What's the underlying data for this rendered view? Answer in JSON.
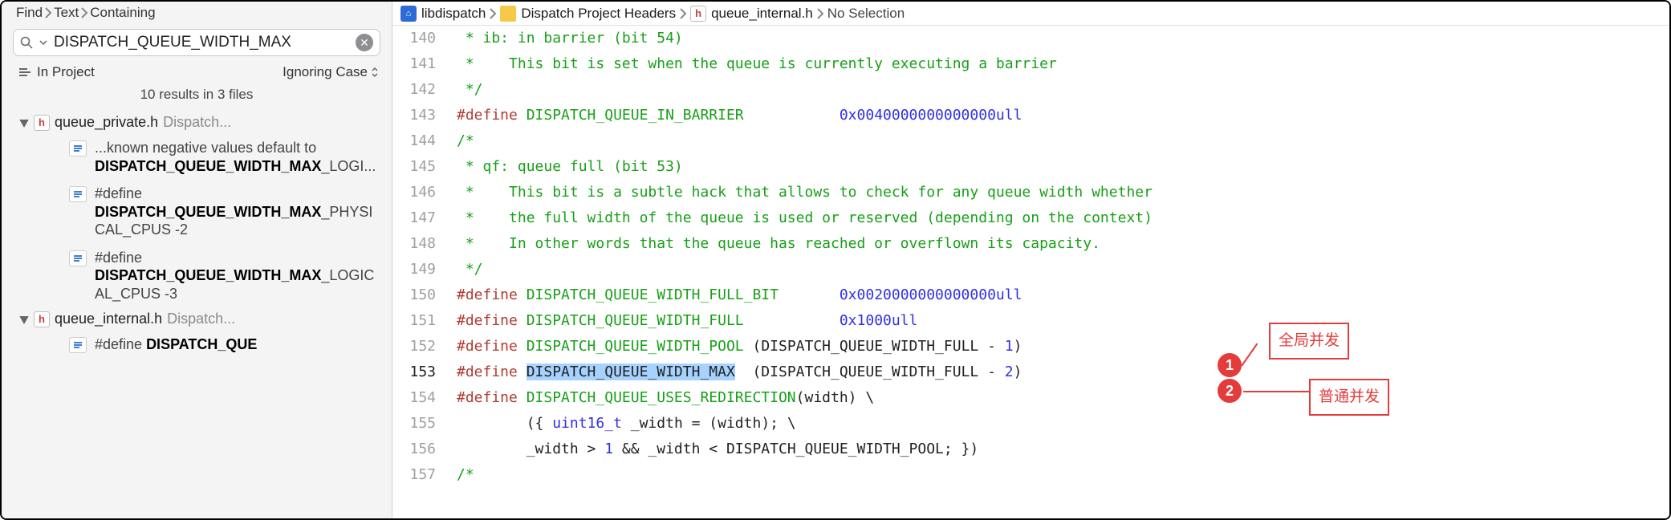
{
  "sidebar": {
    "breadcrumbs": [
      "Find",
      "Text",
      "Containing"
    ],
    "search_value": "DISPATCH_QUEUE_WIDTH_MAX",
    "scope_label": "In Project",
    "case_label": "Ignoring Case",
    "summary": "10 results in 3 files",
    "files": [
      {
        "name": "queue_private.h",
        "trail": "Dispatch...",
        "matches": [
          {
            "pre": "...known negative values default to ",
            "hit": "DISPATCH_QUEUE_WIDTH_MAX",
            "post": "_LOGI..."
          },
          {
            "pre": "#define ",
            "hit": "DISPATCH_QUEUE_WIDTH_MAX",
            "post": "_PHYSICAL_CPUS    -2"
          },
          {
            "pre": "#define ",
            "hit": "DISPATCH_QUEUE_WIDTH_MAX",
            "post": "_LOGICAL_CPUS    -3"
          }
        ]
      },
      {
        "name": "queue_internal.h",
        "trail": "Dispatch...",
        "matches": [
          {
            "pre": "#define ",
            "hit": "DISPATCH_QUE",
            "post": ""
          }
        ]
      }
    ]
  },
  "pathbar": {
    "project": "libdispatch",
    "folder": "Dispatch Project Headers",
    "file": "queue_internal.h",
    "selection": "No Selection"
  },
  "code": {
    "first_line": 140,
    "current_line": 153,
    "lines": [
      {
        "n": 140,
        "segs": [
          [
            "c-comment",
            " * ib: in barrier (bit 54)"
          ]
        ]
      },
      {
        "n": 141,
        "segs": [
          [
            "c-comment",
            " *    This bit is set when the queue is currently executing a barrier"
          ]
        ]
      },
      {
        "n": 142,
        "segs": [
          [
            "c-comment",
            " */"
          ]
        ]
      },
      {
        "n": 143,
        "segs": [
          [
            "c-define",
            "#define "
          ],
          [
            "c-macro",
            "DISPATCH_QUEUE_IN_BARRIER           "
          ],
          [
            "c-num",
            "0x0040000000000000ull"
          ]
        ]
      },
      {
        "n": 144,
        "segs": [
          [
            "c-comment",
            "/*"
          ]
        ]
      },
      {
        "n": 145,
        "segs": [
          [
            "c-comment",
            " * qf: queue full (bit 53)"
          ]
        ]
      },
      {
        "n": 146,
        "segs": [
          [
            "c-comment",
            " *    This bit is a subtle hack that allows to check for any queue width whether"
          ]
        ]
      },
      {
        "n": 147,
        "segs": [
          [
            "c-comment",
            " *    the full width of the queue is used or reserved (depending on the context)"
          ]
        ]
      },
      {
        "n": 148,
        "segs": [
          [
            "c-comment",
            " *    In other words that the queue has reached or overflown its capacity."
          ]
        ]
      },
      {
        "n": 149,
        "segs": [
          [
            "c-comment",
            " */"
          ]
        ]
      },
      {
        "n": 150,
        "segs": [
          [
            "c-define",
            "#define "
          ],
          [
            "c-macro",
            "DISPATCH_QUEUE_WIDTH_FULL_BIT       "
          ],
          [
            "c-num",
            "0x0020000000000000ull"
          ]
        ]
      },
      {
        "n": 151,
        "segs": [
          [
            "c-define",
            "#define "
          ],
          [
            "c-macro",
            "DISPATCH_QUEUE_WIDTH_FULL           "
          ],
          [
            "c-num",
            "0x1000ull"
          ]
        ]
      },
      {
        "n": 152,
        "segs": [
          [
            "c-define",
            "#define "
          ],
          [
            "c-macro",
            "DISPATCH_QUEUE_WIDTH_POOL"
          ],
          [
            "",
            " (DISPATCH_QUEUE_WIDTH_FULL - "
          ],
          [
            "c-num",
            "1"
          ],
          [
            "",
            ")"
          ]
        ]
      },
      {
        "n": 153,
        "segs": [
          [
            "c-define",
            "#define "
          ],
          [
            "c-hl",
            "DISPATCH_QUEUE_WIDTH_MAX"
          ],
          [
            "",
            "  (DISPATCH_QUEUE_WIDTH_FULL - "
          ],
          [
            "c-num",
            "2"
          ],
          [
            "",
            ")"
          ]
        ]
      },
      {
        "n": 154,
        "segs": [
          [
            "c-define",
            "#define "
          ],
          [
            "c-macro",
            "DISPATCH_QUEUE_USES_REDIRECTION"
          ],
          [
            "",
            "(width) \\"
          ]
        ]
      },
      {
        "n": 155,
        "segs": [
          [
            "",
            "        ({ "
          ],
          [
            "c-num",
            "uint16_t"
          ],
          [
            "",
            " _width = (width); \\"
          ]
        ]
      },
      {
        "n": 156,
        "segs": [
          [
            "",
            "        _width > "
          ],
          [
            "c-num",
            "1"
          ],
          [
            "",
            " && _width < DISPATCH_QUEUE_WIDTH_POOL; })"
          ]
        ]
      },
      {
        "n": 157,
        "segs": [
          [
            "c-comment",
            "/*"
          ]
        ]
      }
    ]
  },
  "annotations": {
    "badge1": "1",
    "badge2": "2",
    "label1": "全局并发",
    "label2": "普通并发"
  }
}
